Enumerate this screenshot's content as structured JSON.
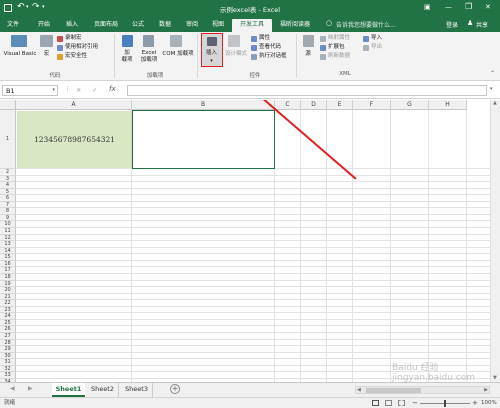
{
  "titlebar": {
    "title": "示例excel表 - Excel",
    "save_icon": "save-icon",
    "undo_icon": "undo-icon",
    "redo_icon": "redo-icon",
    "min": "—",
    "restore": "❐",
    "close": "✕",
    "ribbon_opts": "▣"
  },
  "tabs": [
    "文件",
    "开始",
    "插入",
    "页面布局",
    "公式",
    "数据",
    "审阅",
    "视图",
    "开发工具",
    "福昕阅读器"
  ],
  "active_tab": "开发工具",
  "tell_me": "告诉我您想要做什么...",
  "login": "登录",
  "share": "共享",
  "ribbon": {
    "code": {
      "visual_basic": "Visual Basic",
      "macros": "宏",
      "record": "录制宏",
      "relative": "使用相对引用",
      "security": "宏安全性",
      "label": "代码"
    },
    "addins": {
      "addins": "加\n载项",
      "excel_addins": "Excel\n加载项",
      "com_addins": "COM 加载项",
      "label": "加载项"
    },
    "controls": {
      "insert": "插入",
      "design": "设计模式",
      "properties": "属性",
      "view_code": "查看代码",
      "dialog": "执行对话框",
      "label": "控件"
    },
    "xml": {
      "source": "源",
      "map_props": "映射属性",
      "expansion": "扩展包",
      "refresh": "刷新数据",
      "import": "导入",
      "export": "导出",
      "label": "XML"
    }
  },
  "formula_bar": {
    "name_box": "B1",
    "cancel": "✕",
    "enter": "✓",
    "fx": "fx",
    "value": ""
  },
  "columns": [
    "A",
    "B",
    "C",
    "D",
    "E",
    "F",
    "G",
    "H"
  ],
  "rows": [
    "1",
    "2",
    "3",
    "4",
    "5",
    "6",
    "7",
    "8",
    "9",
    "10",
    "11",
    "12",
    "13",
    "14",
    "15",
    "16",
    "17",
    "18",
    "19",
    "20",
    "21",
    "22",
    "23",
    "24",
    "25",
    "26",
    "27",
    "28",
    "29",
    "30",
    "31",
    "32",
    "33",
    "34"
  ],
  "cell_a1": "12345678987654321",
  "sheets": [
    "Sheet1",
    "Sheet2",
    "Sheet3"
  ],
  "active_sheet": "Sheet1",
  "status": {
    "ready": "就绪",
    "zoom": "100%"
  },
  "watermark": "Baidu 经验 jingyan.baidu.com",
  "colors": {
    "excel_green": "#217346",
    "cell_fill": "#d9e7c4",
    "highlight": "#e02020"
  }
}
